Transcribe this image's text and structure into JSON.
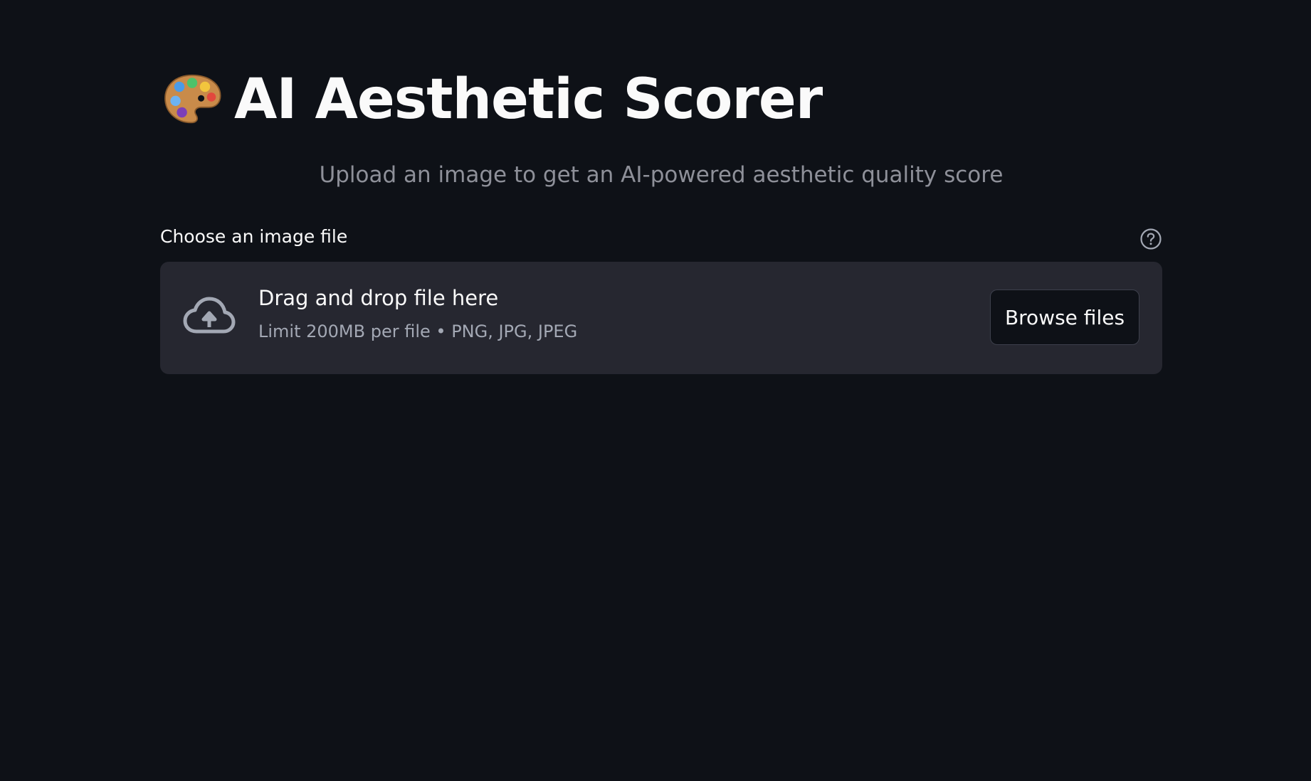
{
  "header": {
    "title": "AI Aesthetic Scorer",
    "title_icon": "artist-palette-icon",
    "subtitle": "Upload an image to get an AI-powered aesthetic quality score"
  },
  "uploader": {
    "label": "Choose an image file",
    "help_icon": "help-circle-icon",
    "drop_instructions": "Drag and drop file here",
    "limit_text": "Limit 200MB per file • PNG, JPG, JPEG",
    "upload_icon": "cloud-upload-icon",
    "browse_label": "Browse files"
  },
  "colors": {
    "background": "#0e1117",
    "dropzone": "#262730",
    "text": "#fafafa",
    "muted_text": "#8e9099"
  }
}
